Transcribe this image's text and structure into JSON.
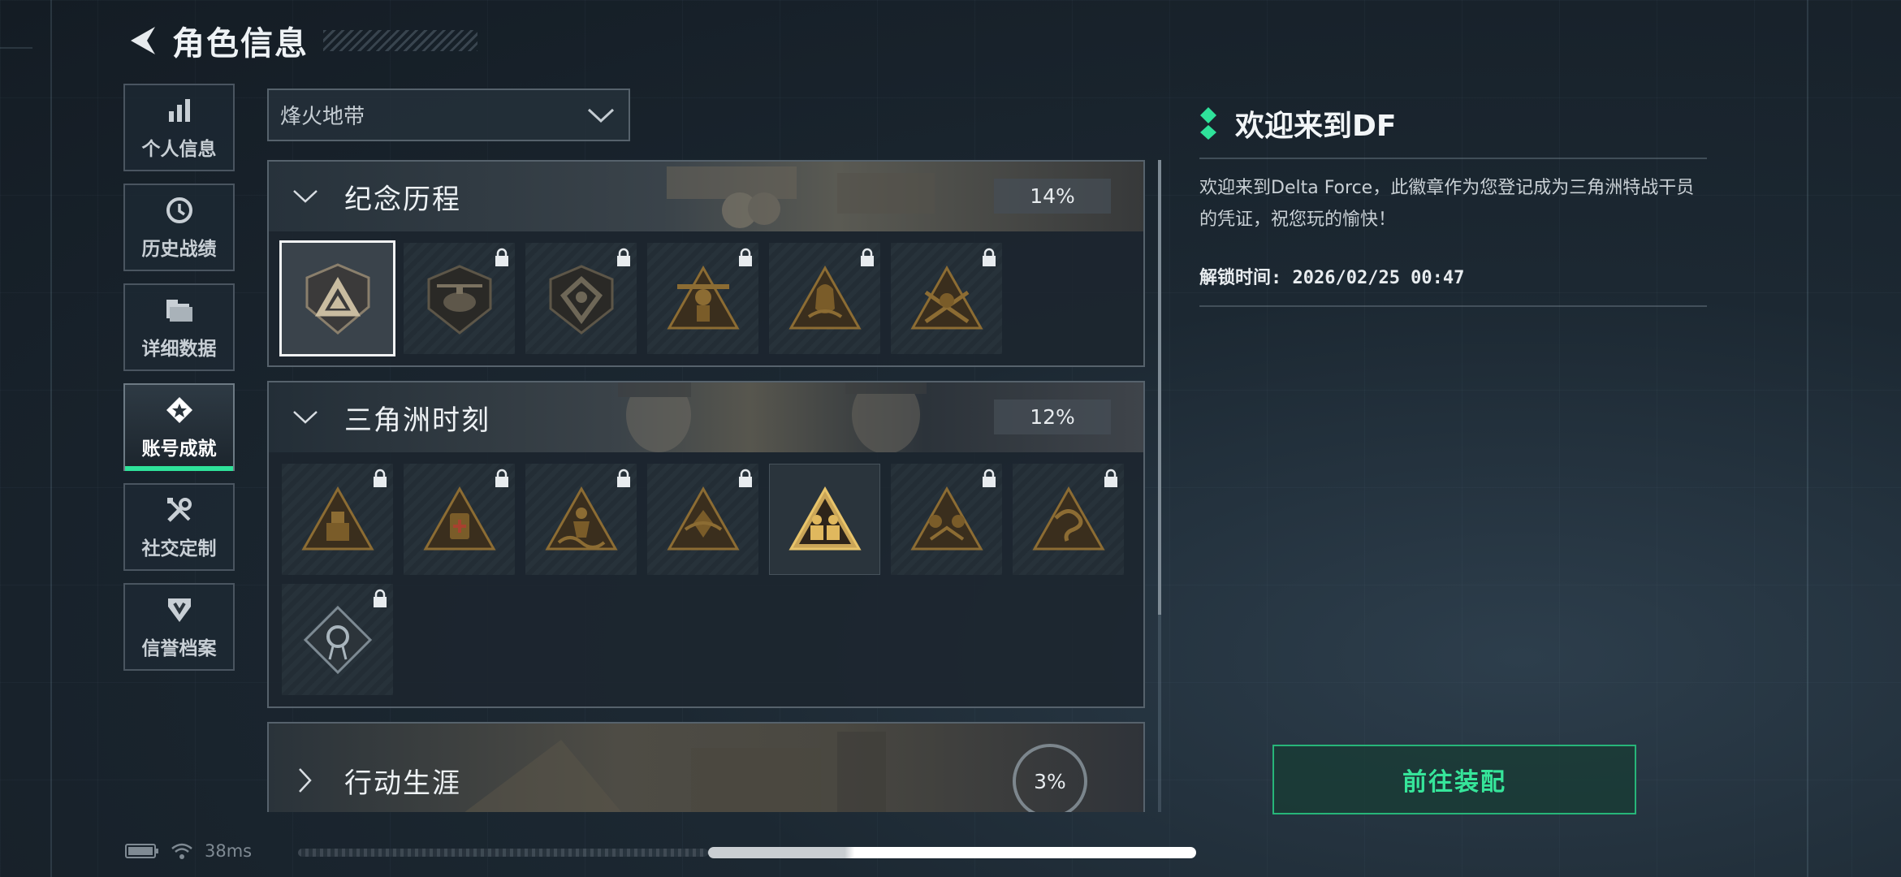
{
  "header": {
    "title": "角色信息",
    "back_icon": "back-arrow-icon"
  },
  "sidebar": {
    "items": [
      {
        "label": "个人信息",
        "icon": "bar-chart-icon",
        "active": false
      },
      {
        "label": "历史战绩",
        "icon": "history-clock-icon",
        "active": false
      },
      {
        "label": "详细数据",
        "icon": "folder-icon",
        "active": false
      },
      {
        "label": "账号成就",
        "icon": "achievement-icon",
        "active": true
      },
      {
        "label": "社交定制",
        "icon": "tools-icon",
        "active": false
      },
      {
        "label": "信誉档案",
        "icon": "credit-shield-icon",
        "active": false
      }
    ],
    "accent_color": "#2fe29a"
  },
  "filter": {
    "selected": "烽火地带"
  },
  "sections": [
    {
      "title": "纪念历程",
      "percent": "14%",
      "expanded": true,
      "badges": [
        {
          "name": "delta-emblem-badge",
          "locked": false,
          "selected": true
        },
        {
          "name": "helicopter-badge",
          "locked": true
        },
        {
          "name": "hex-emblem-badge",
          "locked": true
        },
        {
          "name": "winged-soldier-badge",
          "locked": true
        },
        {
          "name": "operator-portrait-badge",
          "locked": true
        },
        {
          "name": "crossed-rifles-badge",
          "locked": true
        }
      ]
    },
    {
      "title": "三角洲时刻",
      "percent": "12%",
      "expanded": true,
      "badges": [
        {
          "name": "soldier-triangle-badge",
          "locked": true
        },
        {
          "name": "medic-badge",
          "locked": true
        },
        {
          "name": "wave-fighter-badge",
          "locked": true
        },
        {
          "name": "lotus-badge",
          "locked": true
        },
        {
          "name": "squad-badge",
          "locked": false
        },
        {
          "name": "beast-squad-badge",
          "locked": true
        },
        {
          "name": "dragon-badge",
          "locked": true
        },
        {
          "name": "rose-diamond-badge",
          "locked": true
        }
      ]
    },
    {
      "title": "行动生涯",
      "percent": "3%",
      "expanded": false,
      "badges": []
    }
  ],
  "detail": {
    "title": "欢迎来到DF",
    "description": "欢迎来到Delta Force，此徽章作为您登记成为三角洲特战干员的凭证，祝您玩的愉快！",
    "unlock_time": "解锁时间: 2026/02/25 00:47",
    "accent_color": "#2fe29a"
  },
  "equip_button": {
    "label": "前往装配"
  },
  "status": {
    "ping": "38ms"
  }
}
